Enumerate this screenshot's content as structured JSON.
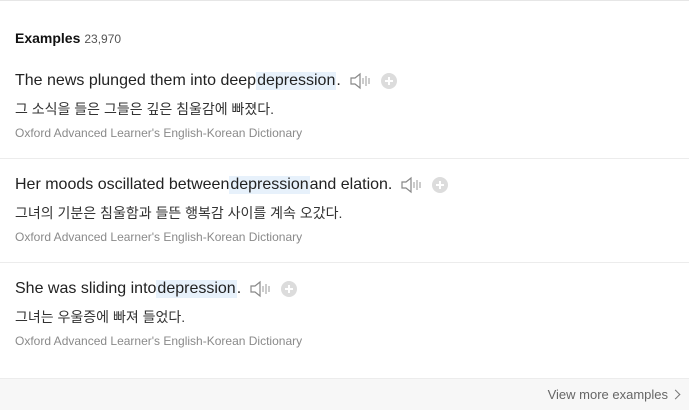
{
  "header": {
    "title": "Examples",
    "count": "23,970"
  },
  "examples": [
    {
      "before": "The news plunged them into deep ",
      "highlight": "depression",
      "after": ".",
      "korean": "그 소식을 들은 그들은 깊은 침울감에 빠졌다.",
      "source": "Oxford Advanced Learner's English-Korean Dictionary"
    },
    {
      "before": "Her moods oscillated between ",
      "highlight": "depression",
      "after": " and elation.",
      "korean": "그녀의 기분은 침울함과 들뜬 행복감 사이를 계속 오갔다.",
      "source": "Oxford Advanced Learner's English-Korean Dictionary"
    },
    {
      "before": "She was sliding into ",
      "highlight": "depression",
      "after": ".",
      "korean": "그녀는 우울증에 빠져 들었다.",
      "source": "Oxford Advanced Learner's English-Korean Dictionary"
    }
  ],
  "footer": {
    "view_more": "View more examples"
  },
  "icons": {
    "speaker": "speaker-icon",
    "add": "plus-circle-icon"
  }
}
